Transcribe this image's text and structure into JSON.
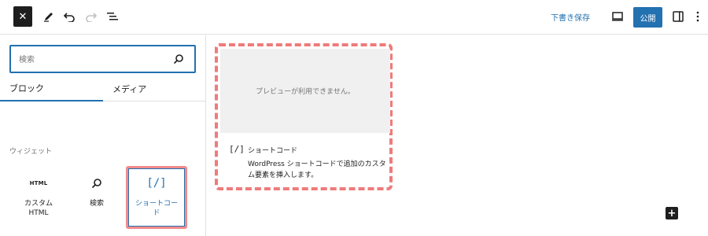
{
  "header": {
    "close_label": "✕",
    "save_draft": "下書き保存",
    "publish": "公開"
  },
  "sidebar": {
    "search": {
      "placeholder": "検索",
      "value": ""
    },
    "tabs": [
      {
        "label": "ブロック",
        "active": true
      },
      {
        "label": "メディア",
        "active": false
      }
    ],
    "section_label": "ウィジェット",
    "blocks": [
      {
        "glyph": "HTML",
        "label": "カスタム HTML"
      },
      {
        "glyph": "",
        "label": "検索"
      },
      {
        "glyph": "[/]",
        "label": "ショートコード",
        "selected": true
      }
    ]
  },
  "canvas": {
    "preview_text": "プレビューが利用できません。",
    "card_icon": "[/]",
    "card_title": "ショートコード",
    "card_description": "WordPress ショートコードで追加のカスタム要素を挿入します。",
    "add_label": "+"
  },
  "colors": {
    "accent": "#2271b1",
    "highlight": "#ef7b7b",
    "dark": "#1e1e1e"
  },
  "icons": [
    "close-icon",
    "pencil-icon",
    "undo-icon",
    "redo-icon",
    "list-view-icon",
    "desktop-preview-icon",
    "sidebar-toggle-icon",
    "more-options-icon",
    "search-icon",
    "plus-icon"
  ]
}
